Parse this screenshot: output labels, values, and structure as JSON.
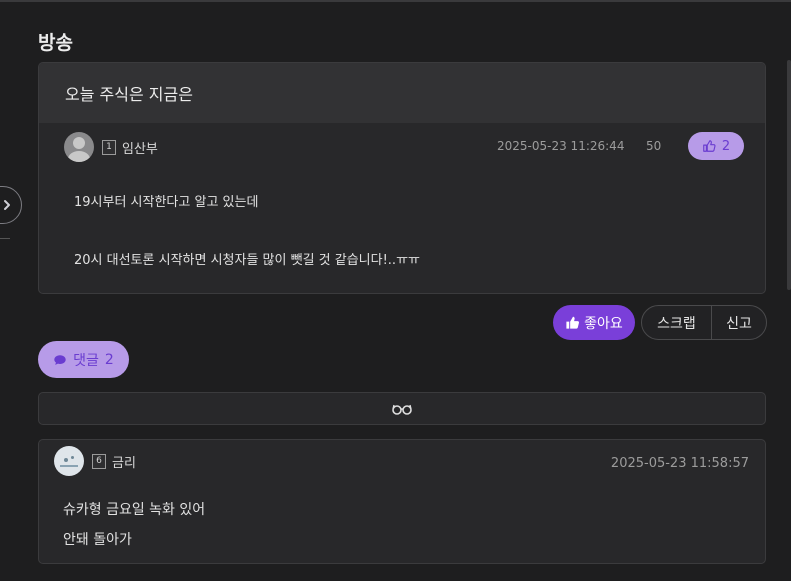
{
  "board": {
    "title": "방송"
  },
  "post": {
    "title": "오늘 주식은 지금은",
    "author": {
      "level": "1",
      "nickname": "임산부"
    },
    "date": "2025-05-23 11:26:44",
    "views": "50",
    "likes": "2",
    "content": [
      "19시부터 시작한다고 알고 있는데",
      "20시 대선토론 시작하면 시청자들 많이 뺏길 것 같습니다!..ㅠㅠ"
    ]
  },
  "actions": {
    "like_label": "좋아요",
    "scrap_label": "스크랩",
    "report_label": "신고"
  },
  "comments_toggle": {
    "label": "댓글",
    "count": "2"
  },
  "comment": {
    "author": {
      "level": "6",
      "nickname": "금리"
    },
    "date": "2025-05-23 11:58:57",
    "lines": [
      "슈카형 금요일 녹화 있어",
      "안돼 돌아가"
    ]
  },
  "icons": {
    "side_button": "chevron-right-icon",
    "thumb": "thumbs-up-icon",
    "comment": "speech-bubble-icon",
    "glasses": "glasses-icon"
  },
  "colors": {
    "background": "#1e1e1f",
    "accent": "#7a3fd9",
    "accent_soft": "#b79be8"
  }
}
